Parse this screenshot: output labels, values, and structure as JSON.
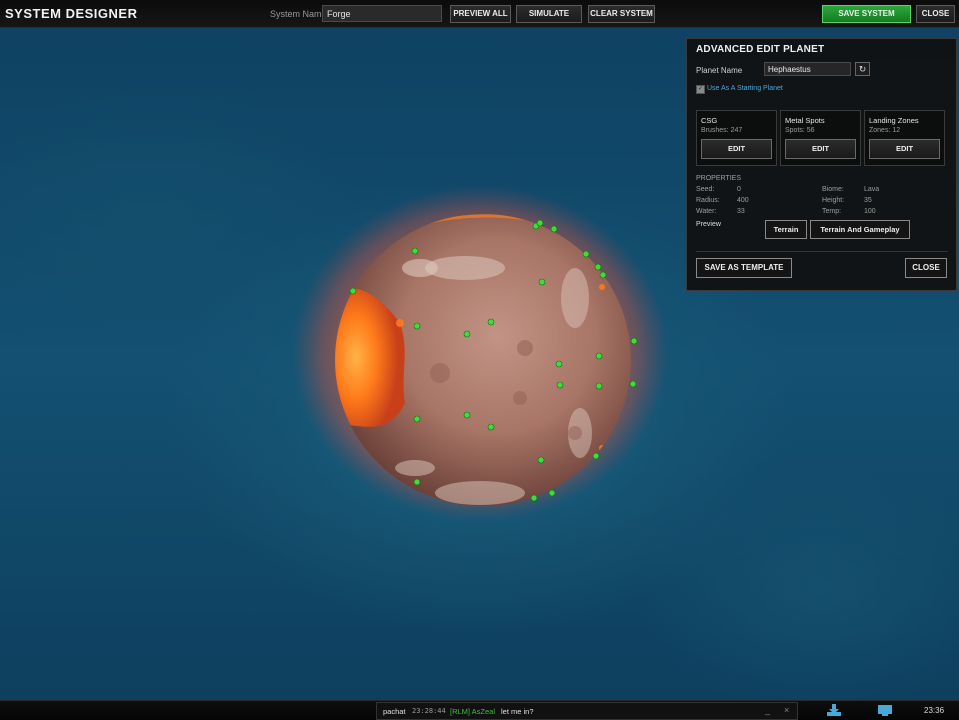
{
  "header": {
    "title": "SYSTEM DESIGNER",
    "system_name_label": "System Name:",
    "system_name_value": "Forge",
    "buttons": {
      "preview_all": "PREVIEW ALL",
      "simulate": "SIMULATE",
      "clear_system": "CLEAR SYSTEM",
      "save_system": "SAVE SYSTEM",
      "close": "CLOSE"
    }
  },
  "panel": {
    "title": "ADVANCED EDIT PLANET",
    "planet_name_label": "Planet Name",
    "planet_name_value": "Hephaestus",
    "starting_planet_label": "Use As A Starting Planet",
    "starting_planet_checked": true,
    "sections": [
      {
        "title": "CSG",
        "stat": "Brushes: 247",
        "button": "EDIT"
      },
      {
        "title": "Metal Spots",
        "stat": "Spots: 56",
        "button": "EDIT"
      },
      {
        "title": "Landing Zones",
        "stat": "Zones: 12",
        "button": "EDIT"
      }
    ],
    "properties_title": "PROPERTIES",
    "properties_left": [
      {
        "label": "Seed:",
        "value": "0"
      },
      {
        "label": "Radius:",
        "value": "400"
      },
      {
        "label": "Water:",
        "value": "33"
      }
    ],
    "properties_right": [
      {
        "label": "Biome:",
        "value": "Lava"
      },
      {
        "label": "Height:",
        "value": "35"
      },
      {
        "label": "Temp:",
        "value": "100"
      }
    ],
    "preview_label": "Preview",
    "preview_buttons": {
      "terrain": "Terrain",
      "terrain_gameplay": "Terrain And Gameplay"
    },
    "save_template": "SAVE AS TEMPLATE",
    "close": "CLOSE"
  },
  "chat": {
    "channel": "pachat",
    "time": "23:28:44",
    "tag": "[RLM] AsZeal",
    "message": "let me in?",
    "minimize": "_",
    "close": "×"
  },
  "taskbar": {
    "clock": "23:36",
    "icons": [
      "download-icon",
      "monitor-icon"
    ]
  },
  "colors": {
    "accent_green": "#2aa83a",
    "link_blue": "#4fa6d8",
    "metal_spot": "#3ddc3a",
    "lava": "#ff7a1a"
  }
}
